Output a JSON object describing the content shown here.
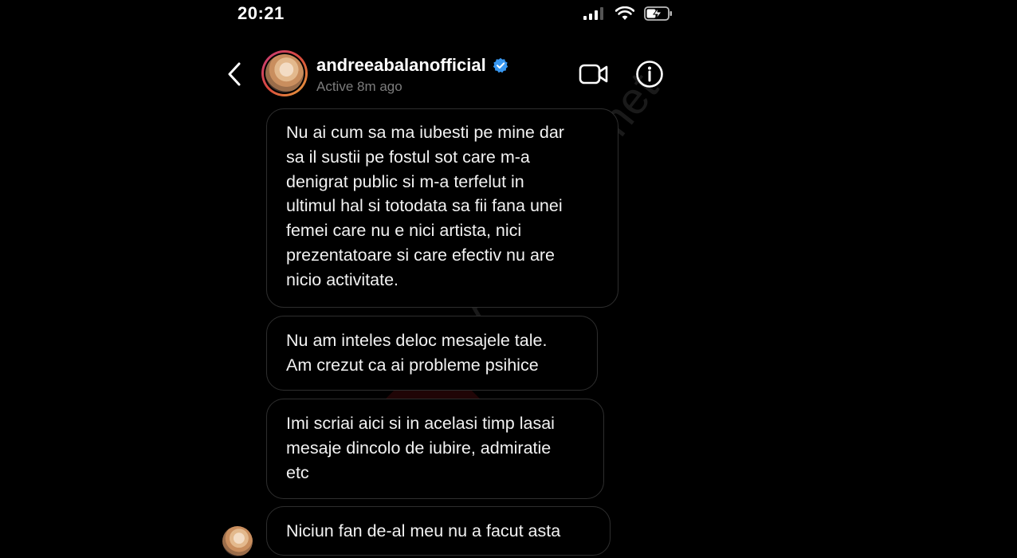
{
  "status_bar": {
    "time": "20:21",
    "signal_icon": "cellular-signal-icon",
    "wifi_icon": "wifi-icon",
    "battery_icon": "battery-charging-icon"
  },
  "header": {
    "username": "andreeabalanofficial",
    "active_status": "Active 8m ago",
    "verified_icon": "verified-badge-icon",
    "back_icon": "chevron-left-icon",
    "video_icon": "video-call-icon",
    "info_icon": "info-icon",
    "accent_color": "#3897f0"
  },
  "messages": [
    {
      "text": "Nu ai cum sa ma iubesti pe mine dar\nsa il sustii pe fostul sot care m-a\ndenigrat public si m-a terfelut in\nultimul hal si totodata sa fii fana unei\nfemei care nu e nici artista, nici\nprezentatoare si care efectiv nu are\nnicio activitate."
    },
    {
      "text": "Nu am inteles deloc mesajele tale.\nAm crezut ca ai probleme psihice"
    },
    {
      "text": "Imi scriai aici si in acelasi timp lasai\nmesaje dincolo de iubire, admiratie\netc"
    },
    {
      "text": "Niciun fan de-al meu nu a facut asta"
    }
  ],
  "watermark": {
    "text": "Actualitate.net"
  }
}
